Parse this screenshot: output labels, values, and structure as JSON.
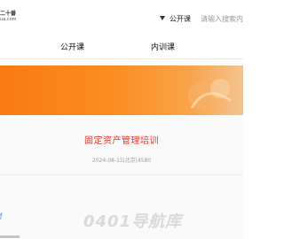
{
  "header": {
    "logo_line1": "二十番",
    "logo_line2": "ua.com",
    "search_type": "公开课",
    "search_placeholder": "请输入搜索内容"
  },
  "nav": {
    "items": [
      {
        "label": "公开课"
      },
      {
        "label": "内训课"
      }
    ]
  },
  "banner": {
    "accent_colors": [
      "#f97a12",
      "#f3c48f"
    ]
  },
  "article": {
    "title": "固定资产管理培训",
    "meta": "2024-08-15|北京|4580"
  },
  "side": {
    "left_mark": "ƒ"
  },
  "watermark": {
    "text": "0401导航库"
  }
}
